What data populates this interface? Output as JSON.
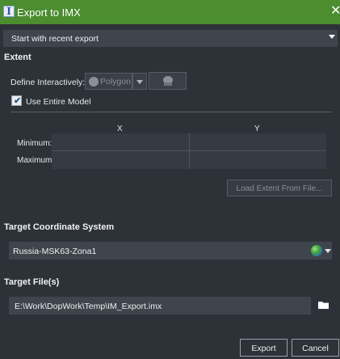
{
  "window": {
    "title": "Export to IMX",
    "app_icon_glyph": "I",
    "close_glyph": "✕",
    "colors": {
      "titlebar": "#4b8d2f",
      "background": "#2d3239"
    }
  },
  "recent": {
    "label": "Start with recent export"
  },
  "extent": {
    "section_title": "Extent",
    "define_label": "Define Interactively:",
    "polygon_label": "Polygon",
    "use_entire_model_label": "Use Entire Model",
    "use_entire_model_checked": true,
    "columns": [
      "X",
      "Y"
    ],
    "rows": [
      {
        "label": "Minimum:",
        "x": "",
        "y": ""
      },
      {
        "label": "Maximum:",
        "x": "",
        "y": ""
      }
    ],
    "load_button": "Load Extent From File..."
  },
  "coordinate_system": {
    "section_title": "Target Coordinate System",
    "value": "Russia-MSK63-Zona1",
    "icon": "globe-icon"
  },
  "target_files": {
    "section_title": "Target File(s)",
    "value": "E:\\Work\\DopWork\\Temp\\IM_Export.imx",
    "icon": "folder-icon"
  },
  "buttons": {
    "export": "Export",
    "cancel": "Cancel"
  }
}
